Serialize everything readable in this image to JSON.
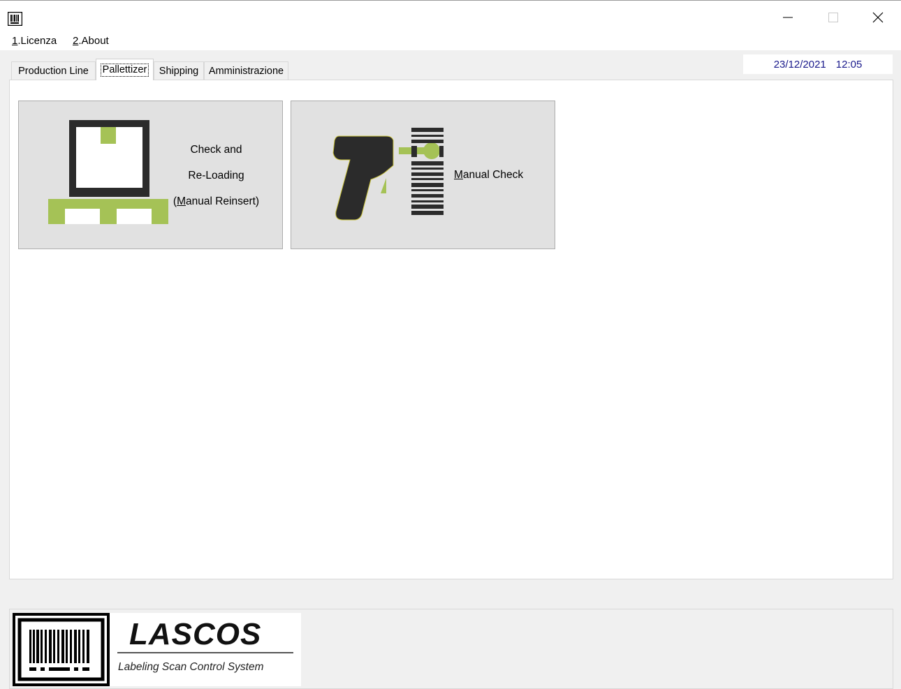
{
  "window": {
    "controls": {
      "minimize": "—",
      "maximize": "☐",
      "close": "✕"
    }
  },
  "menu": {
    "items": [
      {
        "key": "1",
        "label": ".Licenza"
      },
      {
        "key": "2",
        "label": ".About"
      }
    ]
  },
  "tabs": [
    {
      "label": "Production Line",
      "selected": false
    },
    {
      "label": "Pallettizer",
      "selected": true
    },
    {
      "label": "Shipping",
      "selected": false
    },
    {
      "label": "Amministrazione",
      "selected": false
    }
  ],
  "status": {
    "date": "23/12/2021",
    "time": "12:05"
  },
  "tiles": {
    "reload": {
      "icon": "pallet-box-icon",
      "line1": "Check and",
      "line2": "Re-Loading",
      "line3_prefix": "(",
      "line3_mnemonic": "M",
      "line3_rest": "anual Reinsert)"
    },
    "manual": {
      "icon": "barcode-scanner-icon",
      "mnemonic": "M",
      "rest": "anual Check"
    }
  },
  "logo": {
    "icon": "barcode-logo-icon",
    "title": "LASCOS",
    "subtitle": "Labeling Scan Control System"
  },
  "colors": {
    "accent_green": "#a5c256",
    "dark": "#2b2b2b",
    "date_text": "#1a1a8c"
  }
}
